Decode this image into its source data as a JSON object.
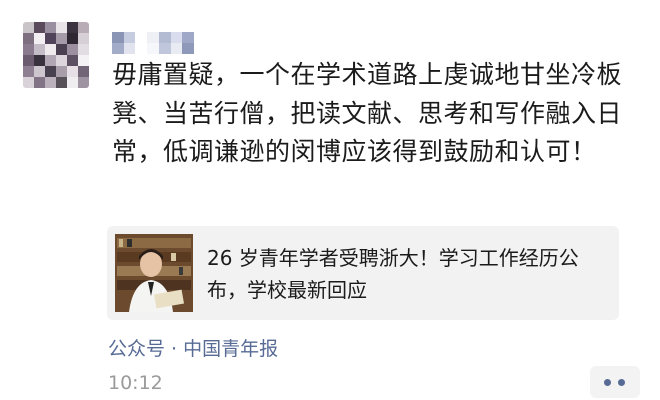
{
  "post": {
    "author_name": "",
    "text": "毋庸置疑，一个在学术道路上虔诚地甘坐冷板凳、当苦行僧，把读文献、思考和写作融入日常，低调谦逊的闵博应该得到鼓励和认可！"
  },
  "link_card": {
    "title": "26 岁青年学者受聘浙大！学习工作经历公布，学校最新回应"
  },
  "source_label": "公众号 · 中国青年报",
  "timestamp": "10:12",
  "icons": {
    "avatar": "blurred-avatar",
    "more": "more-dots-icon"
  },
  "colors": {
    "link_blue": "#576b95",
    "time_gray": "#9a9a9a",
    "card_bg": "#f2f2f2"
  }
}
